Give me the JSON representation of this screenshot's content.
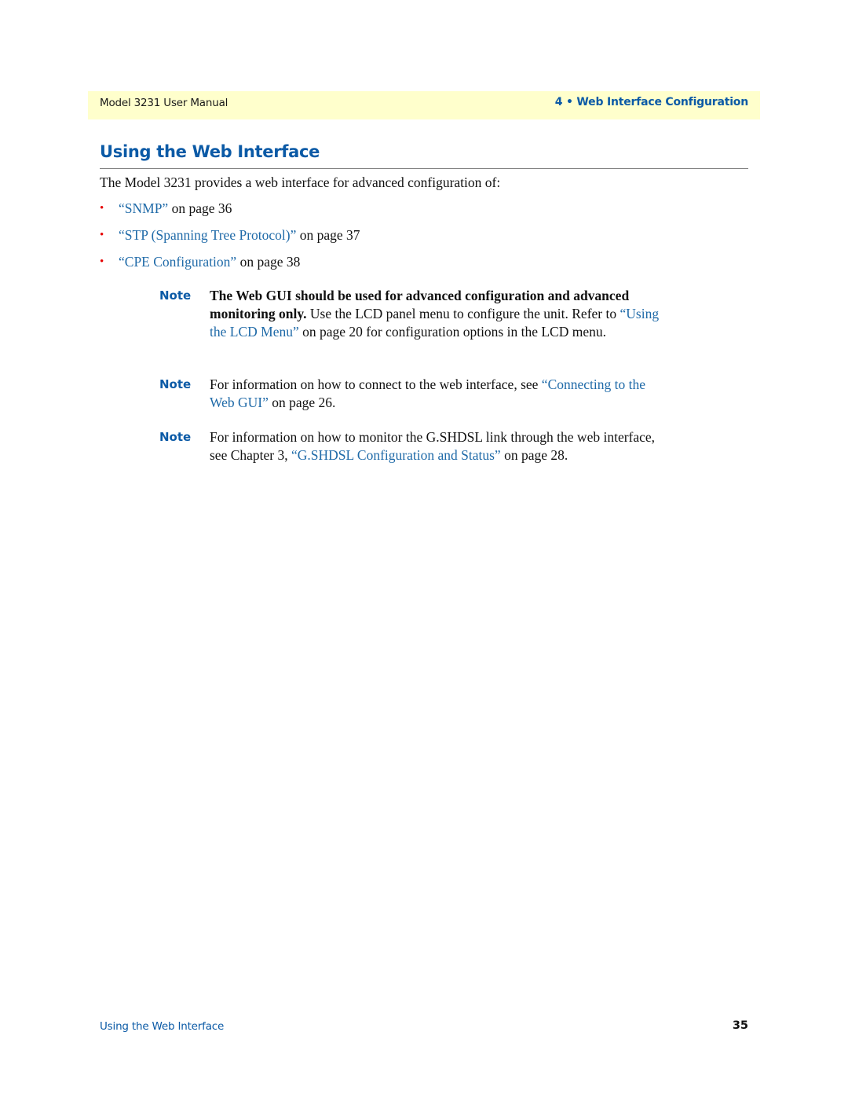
{
  "header": {
    "left": "Model 3231 User Manual",
    "right": "4 • Web Interface Configuration"
  },
  "section": {
    "title": "Using the Web Interface",
    "intro": "The Model 3231 provides a web interface for advanced configuration of:"
  },
  "bullets": [
    {
      "link": "“SNMP”",
      "suffix": " on page 36"
    },
    {
      "link": "“STP (Spanning Tree Protocol)”",
      "suffix": " on page 37"
    },
    {
      "link": "“CPE Configuration”",
      "suffix": " on page 38"
    }
  ],
  "bullet_glyph": "•",
  "notes": [
    {
      "label": "Note",
      "bold": "The Web GUI should be used for advanced configuration and advanced monitoring only.",
      "text1": " Use the LCD panel menu to configure the unit. Refer to ",
      "link": "“Using the LCD Menu”",
      "text2": " on page 20 for configuration options in the LCD menu."
    },
    {
      "label": "Note",
      "text1": "For information on how to connect to the web interface, see ",
      "link": "“Connecting to the Web GUI”",
      "text2": " on page 26."
    },
    {
      "label": "Note",
      "text1": "For information on how to monitor the G.SHDSL link through the web interface, see Chapter 3, ",
      "link": "“G.SHDSL Configuration and Status”",
      "text2": " on page 28."
    }
  ],
  "footer": {
    "left": "Using the Web Interface",
    "page_number": "35"
  },
  "colors": {
    "accent_blue": "#0b5aa6",
    "link_blue": "#1f6aa8",
    "header_band": "#ffffcc",
    "bullet_red": "#e60000"
  }
}
